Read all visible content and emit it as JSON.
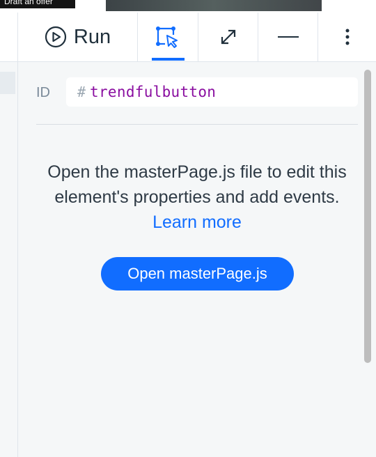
{
  "canvas": {
    "draft_chip": "Draft an offer"
  },
  "toolbar": {
    "run_label": "Run",
    "icons": [
      "play-circle-icon",
      "select-element-icon",
      "expand-icon",
      "minimize-icon",
      "more-vertical-icon"
    ],
    "active_tab": "select-element",
    "accent_color": "#116dff"
  },
  "properties": {
    "id_label": "ID",
    "id_prefix": "#",
    "id_value": "trendfulbutton",
    "description": "Open the masterPage.js file to edit this element's properties and add events.",
    "learn_more": "Learn more",
    "open_button": "Open masterPage.js"
  }
}
